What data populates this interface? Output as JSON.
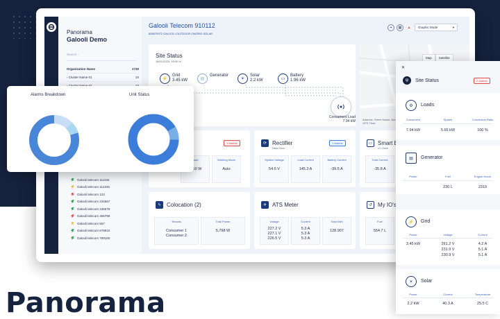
{
  "headline": "Panorama",
  "sidebar": {
    "title": "Panorama",
    "subtitle": "Galooli Demo",
    "search_placeholder": "Search...",
    "table_header": {
      "name": "Organization Name",
      "count": "1730"
    },
    "rows": [
      {
        "name": "Cluster Name 01",
        "count": "10"
      },
      {
        "name": "Cluster Name 02",
        "count": "10"
      }
    ],
    "sites": [
      {
        "name": "Galooli telecom 111234",
        "color": "#2e9e4f"
      },
      {
        "name": "Galooli telecom 112345",
        "color": "#e0c24a"
      },
      {
        "name": "Galooli telecom 123",
        "color": "#e04b4b"
      },
      {
        "name": "Galooli telecom 234567",
        "color": "#2e9e4f"
      },
      {
        "name": "Galooli telecom 345678",
        "color": "#2e9e4f"
      },
      {
        "name": "Galooli telecom 456789",
        "color": "#e04b4b"
      },
      {
        "name": "Galooli telecom 567",
        "color": "#e0c24a"
      },
      {
        "name": "Galooli telecom 678910",
        "color": "#2e9e4f"
      },
      {
        "name": "Galooli telecom 789100",
        "color": "#2e9e4f"
      }
    ]
  },
  "header": {
    "title": "Galooli Telecom 910112",
    "subtitle": "808970972 GALOOLI OUTDOOR ONGRID SOLAR",
    "mode_select": "Graphic Mode"
  },
  "site_status": {
    "title": "Site Status",
    "date": "18/01/2023, 18:00 hr",
    "grid": {
      "label": "Grid",
      "value": "3.45 kW"
    },
    "generator": {
      "label": "Generator"
    },
    "solar": {
      "label": "Solar",
      "value": "2.2 kW"
    },
    "battery": {
      "label": "Battery",
      "value": "1.96 kW"
    },
    "consumers": {
      "label": "Consumers Load",
      "value": "7.94 kW"
    }
  },
  "map": {
    "tab_map": "Map",
    "tab_satellite": "Satellite",
    "address": "Address: Street Name, Area",
    "gps": "GPS Time:"
  },
  "modules": {
    "ac": {
      "badge": "1 Alarms",
      "cols": [
        {
          "h": "Load",
          "v": "3450 W"
        },
        {
          "h": "Working Mode",
          "v": "Auto"
        }
      ]
    },
    "rectifier": {
      "title": "Rectifier",
      "sub": "Delta Orion",
      "badge": "1 Alarms",
      "cols": [
        {
          "h": "System Voltage",
          "v": "54.6 V"
        },
        {
          "h": "Load Current",
          "v": "145.3 A"
        },
        {
          "h": "Battery Current",
          "v": "-39.5 A"
        }
      ]
    },
    "smart_battery": {
      "title": "Smart Batt",
      "sub": "LG Chem",
      "cols": [
        {
          "h": "Total Current",
          "v": "-35.8 A"
        }
      ]
    },
    "colocation": {
      "title": "Colocation (2)",
      "cols": [
        {
          "h": "Tenants",
          "v": "Consumer 1\nConsumer 2"
        },
        {
          "h": "Total Power",
          "v": "5,798 W"
        }
      ]
    },
    "ats": {
      "title": "ATS Meter",
      "cols": [
        {
          "h": "Voltage",
          "v": "227.2 V\n227.1 V\n226.5 V"
        },
        {
          "h": "Current",
          "v": "5.3 A\n5.3 A\n5.3 A"
        },
        {
          "h": "Total kWh",
          "v": "128.907"
        }
      ]
    },
    "myio": {
      "title": "My IO's",
      "cols": [
        {
          "h": "Fuel",
          "v": "554.7 L"
        }
      ]
    }
  },
  "popup": {
    "alarms_title": "Alarms Breakdown",
    "unit_title": "Unit Status"
  },
  "panel": {
    "title": "Site Status",
    "badge": "2 Alarms",
    "loads": {
      "title": "Loads",
      "head": [
        "Consumers",
        "Spares",
        "Conversion Ratio"
      ],
      "vals": [
        "7.94 kW",
        "5.65 kW",
        "100 %"
      ]
    },
    "generator": {
      "title": "Generator",
      "head": [
        "Power",
        "Fuel",
        "Engine Hours"
      ],
      "vals": [
        "",
        "230 L",
        "2319"
      ]
    },
    "grid": {
      "title": "Grid",
      "head": [
        "Power",
        "Voltage",
        "Current"
      ],
      "vals": [
        "3.45 kW",
        "261.2 V\n231.9 V\n230.9 V",
        "4.2 A\n5.1 A\n5.1 A"
      ]
    },
    "solar": {
      "title": "Solar",
      "head": [
        "Power",
        "Current",
        "Temperature"
      ],
      "vals": [
        "2.2 kW",
        "40.3 A",
        "25.5 C"
      ]
    }
  },
  "colors": {
    "navy": "#16233f",
    "accent": "#1f4fa3",
    "alarm": "#e04b4b"
  }
}
